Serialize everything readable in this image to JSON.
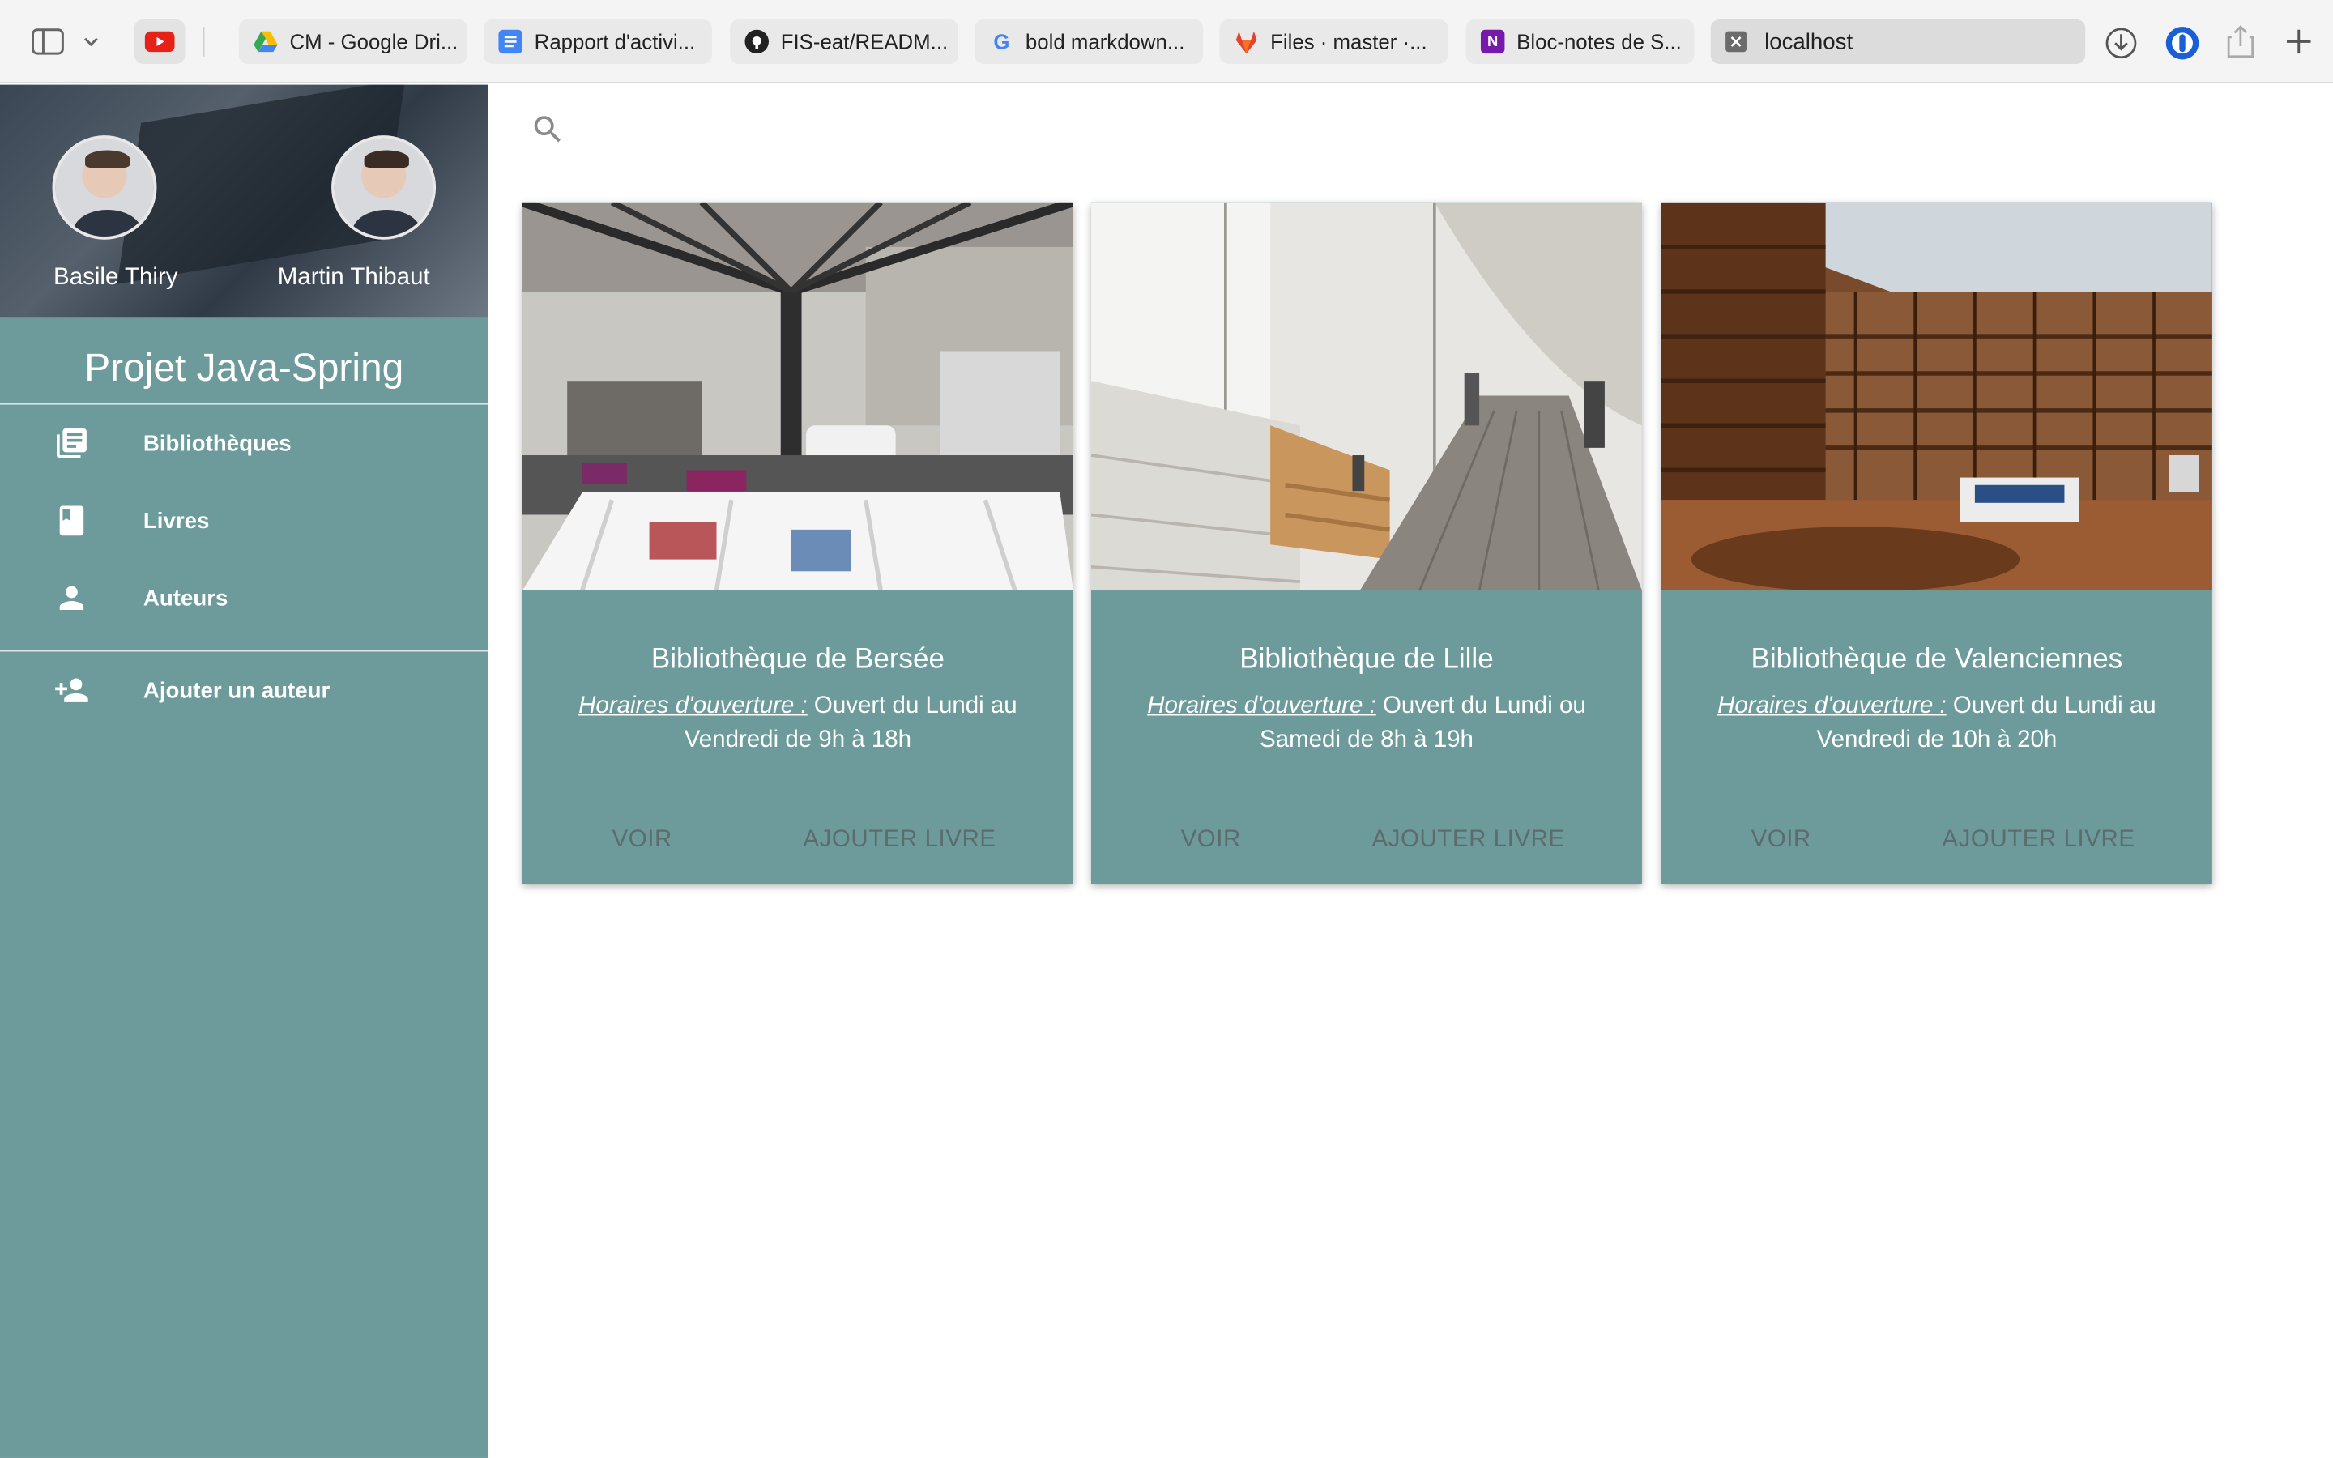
{
  "browser": {
    "tabs": [
      {
        "label": "CM - Google Dri...",
        "icon": "google-drive-icon"
      },
      {
        "label": "Rapport d'activi...",
        "icon": "google-docs-icon"
      },
      {
        "label": "FIS-eat/READM...",
        "icon": "github-icon"
      },
      {
        "label": "bold markdown...",
        "icon": "google-icon"
      },
      {
        "label": "Files · master ·...",
        "icon": "gitlab-icon"
      },
      {
        "label": "Bloc-notes de S...",
        "icon": "onenote-icon"
      }
    ],
    "active_tab": {
      "label": "localhost",
      "icon": "close-icon"
    }
  },
  "sidebar": {
    "members": [
      {
        "name": "Basile Thiry"
      },
      {
        "name": "Martin Thibaut"
      }
    ],
    "title": "Projet Java-Spring",
    "nav": [
      {
        "label": "Bibliothèques",
        "icon": "library-books-icon"
      },
      {
        "label": "Livres",
        "icon": "book-icon"
      },
      {
        "label": "Auteurs",
        "icon": "person-icon"
      }
    ],
    "actions": [
      {
        "label": "Ajouter un auteur",
        "icon": "person-add-icon"
      }
    ]
  },
  "cards": [
    {
      "title": "Bibliothèque de Bersée",
      "hours_label": "Horaires d'ouverture :",
      "hours": " Ouvert du Lundi au Vendredi de 9h à 18h",
      "view_label": "VOIR",
      "add_label": "AJOUTER LIVRE"
    },
    {
      "title": "Bibliothèque de Lille",
      "hours_label": "Horaires d'ouverture :",
      "hours": " Ouvert du Lundi ou Samedi de 8h à 19h",
      "view_label": "VOIR",
      "add_label": "AJOUTER LIVRE"
    },
    {
      "title": "Bibliothèque de Valenciennes",
      "hours_label": "Horaires d'ouverture :",
      "hours": " Ouvert du Lundi au Vendredi de 10h à 20h",
      "view_label": "VOIR",
      "add_label": "AJOUTER LIVRE"
    }
  ],
  "colors": {
    "primary": "#6d9b9c",
    "button_text": "#5c6c6c"
  }
}
